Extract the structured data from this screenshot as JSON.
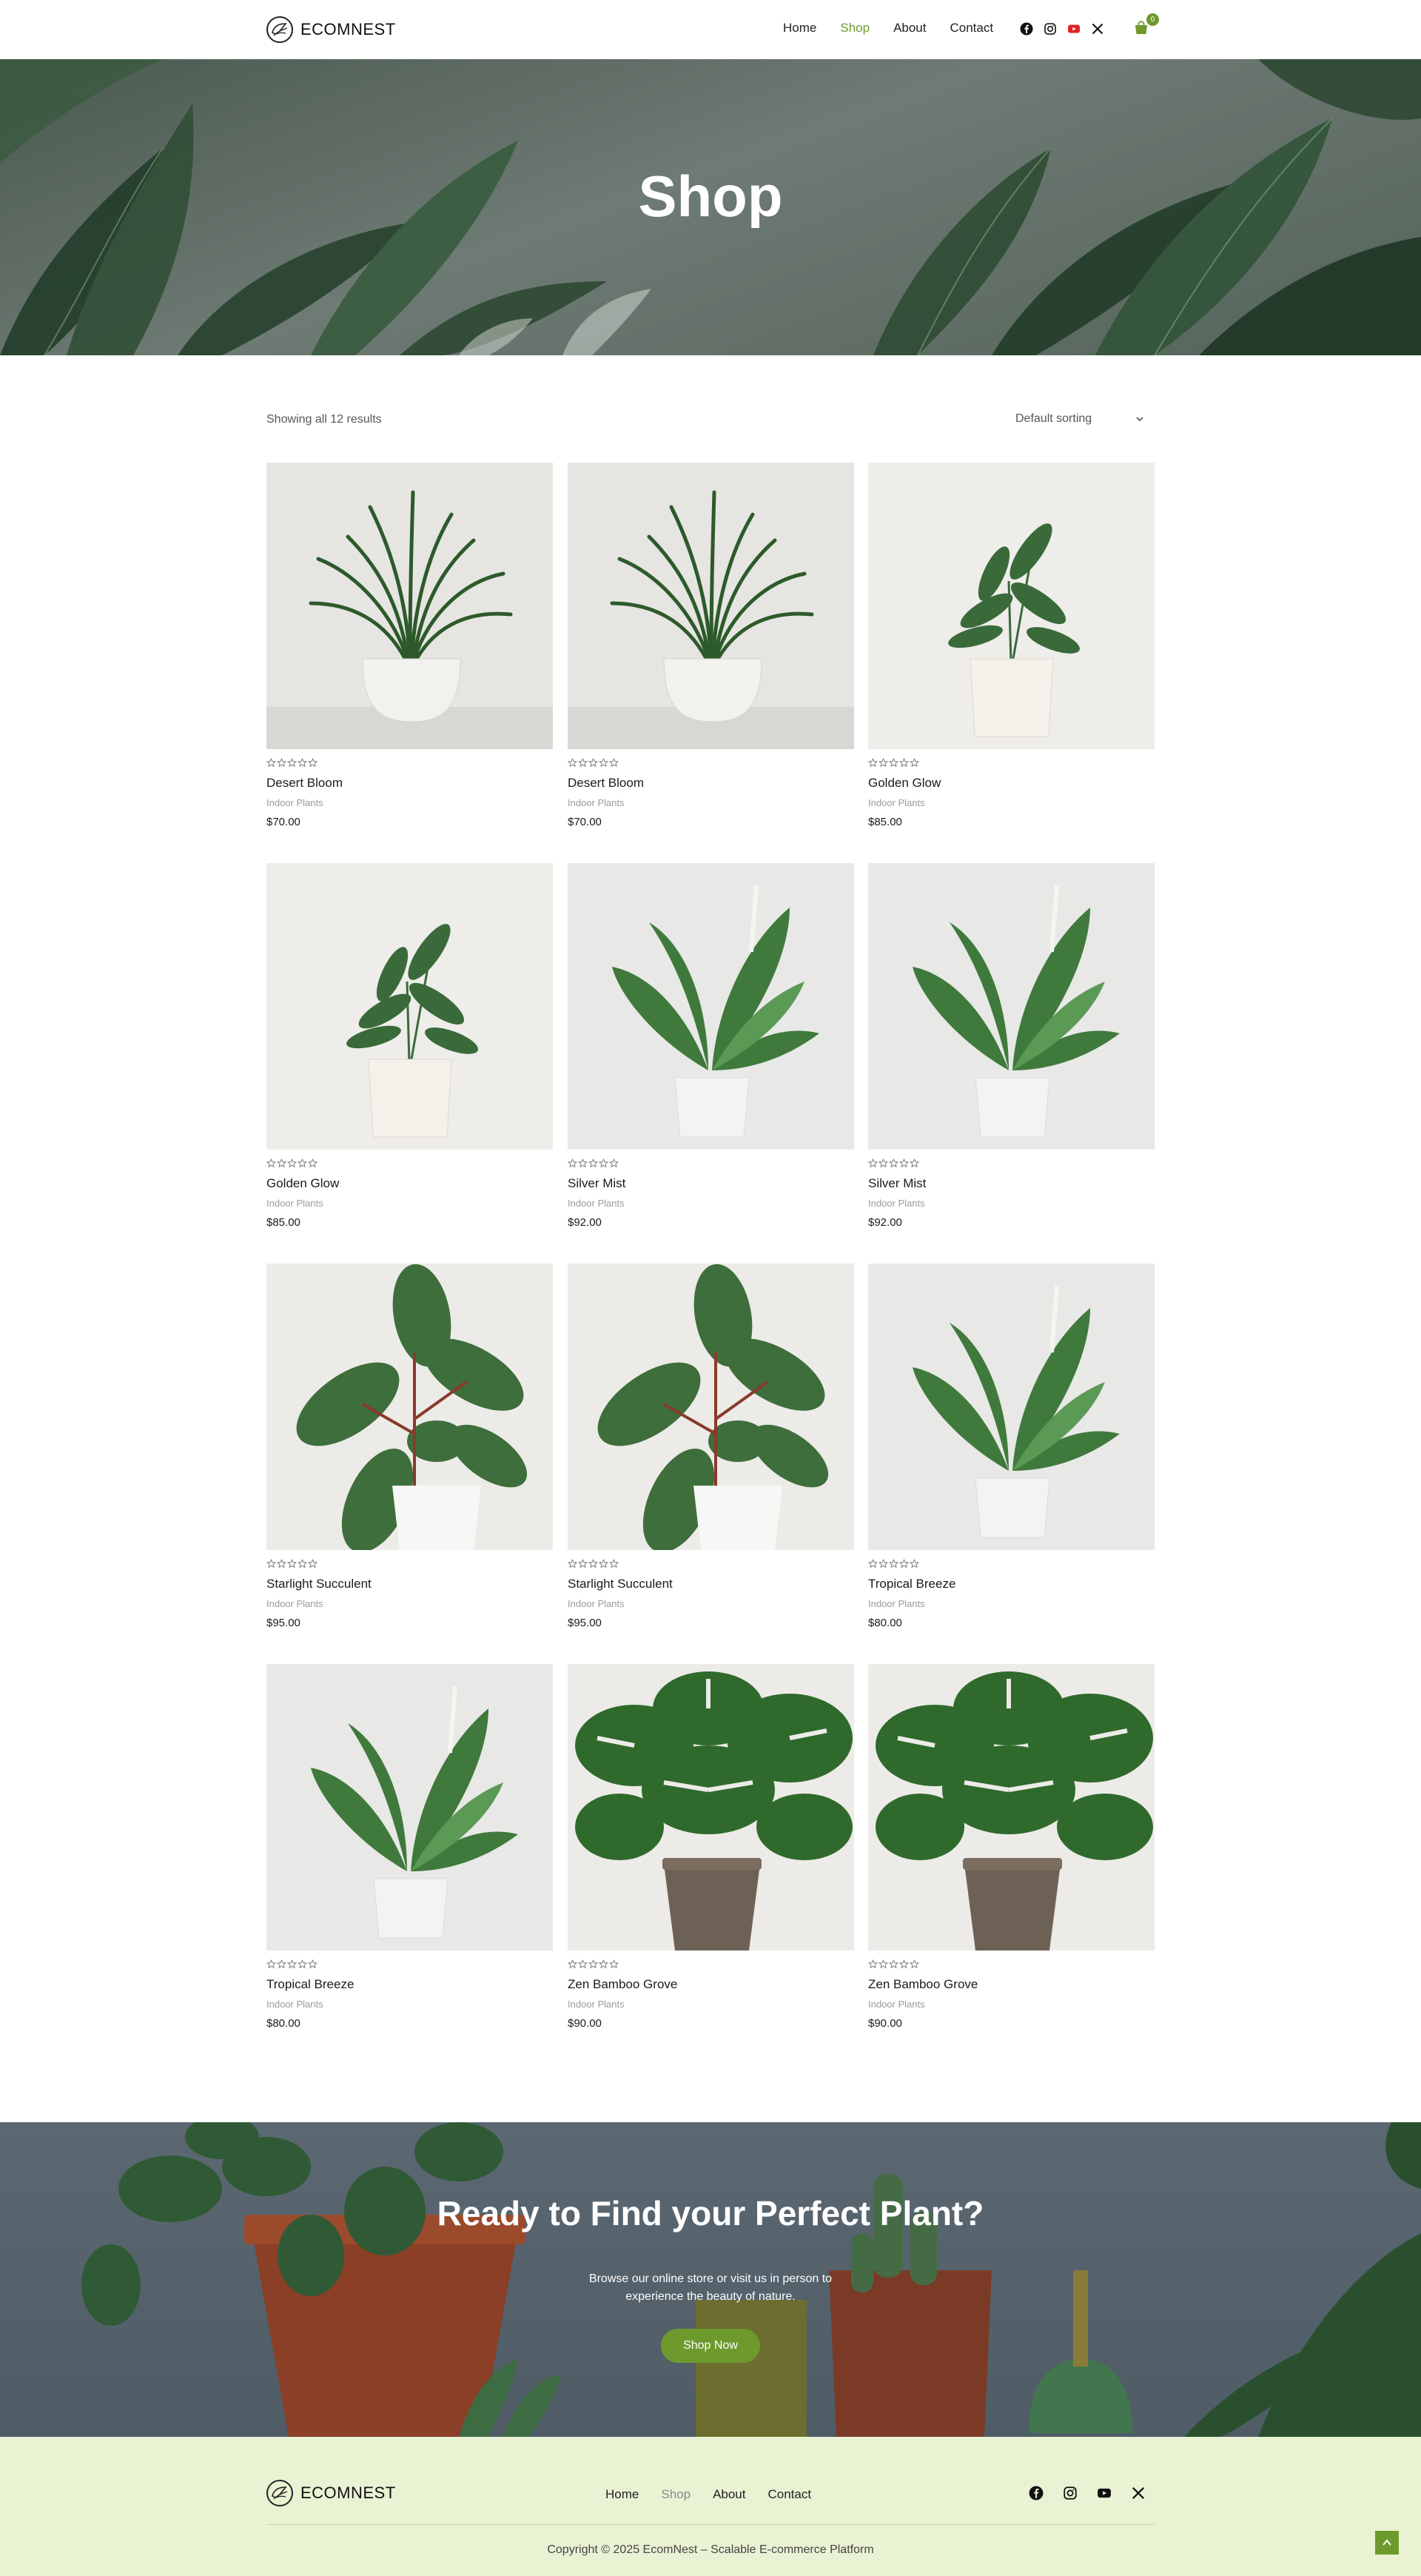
{
  "brand": {
    "name": "ECOMNEST"
  },
  "nav": {
    "items": [
      {
        "label": "Home",
        "active": false
      },
      {
        "label": "Shop",
        "active": true
      },
      {
        "label": "About",
        "active": false
      },
      {
        "label": "Contact",
        "active": false
      }
    ]
  },
  "header_socials": [
    "facebook-icon",
    "instagram-icon",
    "youtube-icon",
    "x-icon"
  ],
  "cart": {
    "count": "0"
  },
  "hero": {
    "title": "Shop"
  },
  "shop": {
    "results_text": "Showing all 12 results",
    "sort_selected": "Default sorting"
  },
  "products": [
    {
      "name": "Desert Bloom",
      "category": "Indoor Plants",
      "price": "$70.00",
      "plant": "spiky",
      "rating": 0
    },
    {
      "name": "Desert Bloom",
      "category": "Indoor Plants",
      "price": "$70.00",
      "plant": "spiky",
      "rating": 0
    },
    {
      "name": "Golden Glow",
      "category": "Indoor Plants",
      "price": "$85.00",
      "plant": "small",
      "rating": 0
    },
    {
      "name": "Golden Glow",
      "category": "Indoor Plants",
      "price": "$85.00",
      "plant": "small",
      "rating": 0
    },
    {
      "name": "Silver Mist",
      "category": "Indoor Plants",
      "price": "$92.00",
      "plant": "broad",
      "rating": 0
    },
    {
      "name": "Silver Mist",
      "category": "Indoor Plants",
      "price": "$92.00",
      "plant": "broad",
      "rating": 0
    },
    {
      "name": "Starlight Succulent",
      "category": "Indoor Plants",
      "price": "$95.00",
      "plant": "rubber",
      "rating": 0
    },
    {
      "name": "Starlight Succulent",
      "category": "Indoor Plants",
      "price": "$95.00",
      "plant": "rubber",
      "rating": 0
    },
    {
      "name": "Tropical Breeze",
      "category": "Indoor Plants",
      "price": "$80.00",
      "plant": "broad",
      "rating": 0
    },
    {
      "name": "Tropical Breeze",
      "category": "Indoor Plants",
      "price": "$80.00",
      "plant": "broad",
      "rating": 0
    },
    {
      "name": "Zen Bamboo Grove",
      "category": "Indoor Plants",
      "price": "$90.00",
      "plant": "monstera",
      "rating": 0
    },
    {
      "name": "Zen Bamboo Grove",
      "category": "Indoor Plants",
      "price": "$90.00",
      "plant": "monstera",
      "rating": 0
    }
  ],
  "cta": {
    "title": "Ready to Find your Perfect Plant?",
    "subtitle": "Browse our online store or visit us in person to experience the beauty of nature.",
    "button_label": "Shop Now"
  },
  "footer": {
    "brand": "ECOMNEST",
    "nav": [
      {
        "label": "Home",
        "active": false
      },
      {
        "label": "Shop",
        "active": true
      },
      {
        "label": "About",
        "active": false
      },
      {
        "label": "Contact",
        "active": false
      }
    ],
    "socials": [
      "facebook-icon",
      "instagram-icon",
      "youtube-icon",
      "x-icon"
    ],
    "copyright": "Copyright © 2025 EcomNest – Scalable E-commerce Platform"
  },
  "colors": {
    "accent": "#6e9a2d",
    "footer_bg": "#eaf2d4",
    "youtube": "#e02424"
  }
}
